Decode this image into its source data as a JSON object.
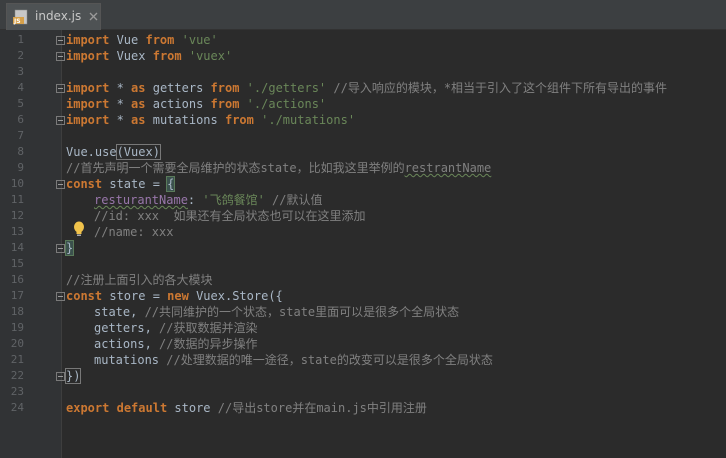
{
  "tab": {
    "label": "index.js",
    "icon": "js-file-icon"
  },
  "line_numbers": [
    "1",
    "2",
    "3",
    "4",
    "5",
    "6",
    "7",
    "8",
    "9",
    "10",
    "11",
    "12",
    "13",
    "14",
    "15",
    "16",
    "17",
    "18",
    "19",
    "20",
    "21",
    "22",
    "23",
    "24"
  ],
  "code": {
    "l1": {
      "kw1": "import",
      "t1": " Vue ",
      "kw2": "from",
      "sp": " ",
      "str": "'vue'"
    },
    "l2": {
      "kw1": "import",
      "t1": " Vuex ",
      "kw2": "from",
      "sp": " ",
      "str": "'vuex'"
    },
    "l4": {
      "kw1": "import",
      "t1": " * ",
      "kw2": "as",
      "t2": " getters ",
      "kw3": "from",
      "sp": " ",
      "str": "'./getters'",
      "cmt": " //导入响应的模块，*相当于引入了这个组件下所有导出的事件"
    },
    "l5": {
      "kw1": "import",
      "t1": " * ",
      "kw2": "as",
      "t2": " actions ",
      "kw3": "from",
      "sp": " ",
      "str": "'./actions'"
    },
    "l6": {
      "kw1": "import",
      "t1": " * ",
      "kw2": "as",
      "t2": " mutations ",
      "kw3": "from",
      "sp": " ",
      "str": "'./mutations'"
    },
    "l8": {
      "t1": "Vue.use",
      "p": "(Vuex)"
    },
    "l9": {
      "cmt": "//首先声明一个需要全局维护的状态state，比如我这里举例的",
      "typo": "restrantName"
    },
    "l10": {
      "kw1": "const",
      "t1": " state = ",
      "brace": "{"
    },
    "l11": {
      "prop": "resturantName",
      "t1": ": ",
      "str": "'飞鸽餐馆'",
      "cmt": " //默认值"
    },
    "l12": {
      "cmt": "//id: xxx  如果还有全局状态也可以在这里添加"
    },
    "l13": {
      "cmt": "//name: xxx"
    },
    "l14": {
      "brace": "}"
    },
    "l16": {
      "cmt": "//注册上面引入的各大模块"
    },
    "l17": {
      "kw1": "const",
      "t1": " store = ",
      "kw2": "new",
      "t2": " Vuex.Store({"
    },
    "l18": {
      "t1": "state, ",
      "cmt": "//共同维护的一个状态，state里面可以是很多个全局状态"
    },
    "l19": {
      "t1": "getters, ",
      "cmt": "//获取数据并渲染"
    },
    "l20": {
      "t1": "actions, ",
      "cmt": "//数据的异步操作"
    },
    "l21": {
      "t1": "mutations ",
      "cmt": "//处理数据的唯一途径，state的改变可以是很多个全局状态"
    },
    "l22": {
      "t1": "})"
    },
    "l24": {
      "kw1": "export",
      "sp1": " ",
      "kw2": "default",
      "t1": " store ",
      "cmt": "//导出store并在main.js中引用注册"
    }
  },
  "colors": {
    "background": "#2b2b2b",
    "keyword": "#cc7832",
    "string": "#6a8759",
    "comment": "#808080",
    "property": "#9876aa",
    "text": "#a9b7c6"
  }
}
